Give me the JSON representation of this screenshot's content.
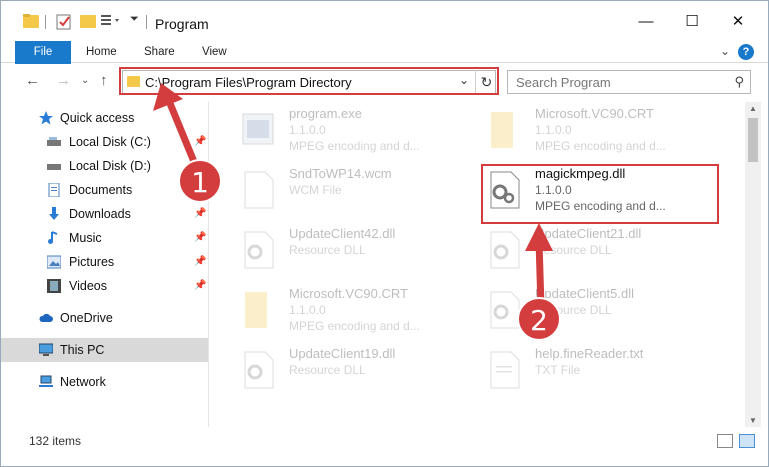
{
  "window": {
    "title": "Program"
  },
  "ribbon": {
    "file": "File",
    "home": "Home",
    "share": "Share",
    "view": "View",
    "help": "?"
  },
  "address": {
    "path": "C:\\Program Files\\Program Directory"
  },
  "search": {
    "placeholder": "Search Program"
  },
  "sidebar": {
    "items": [
      {
        "label": "Quick access"
      },
      {
        "label": "Local Disk (C:)"
      },
      {
        "label": "Local Disk (D:)"
      },
      {
        "label": "Documents"
      },
      {
        "label": "Downloads"
      },
      {
        "label": "Music"
      },
      {
        "label": "Pictures"
      },
      {
        "label": "Videos"
      },
      {
        "label": "OneDrive"
      },
      {
        "label": "This PC"
      },
      {
        "label": "Network"
      }
    ]
  },
  "files": [
    {
      "name": "program.exe",
      "line1": "1.1.0.0",
      "line2": "MPEG encoding and d..."
    },
    {
      "name": "Microsoft.VC90.CRT",
      "line1": "1.1.0.0",
      "line2": "MPEG encoding and d..."
    },
    {
      "name": "SndToWP14.wcm",
      "line1": "WCM File",
      "line2": ""
    },
    {
      "name": "magickmpeg.dll",
      "line1": "1.1.0.0",
      "line2": "MPEG encoding and d..."
    },
    {
      "name": "UpdateClient42.dll",
      "line1": "Resource DLL",
      "line2": ""
    },
    {
      "name": "UpdateClient21.dll",
      "line1": "Resource DLL",
      "line2": ""
    },
    {
      "name": "Microsoft.VC90.CRT",
      "line1": "1.1.0.0",
      "line2": "MPEG encoding and d..."
    },
    {
      "name": "UpdateClient5.dll",
      "line1": "Resource DLL",
      "line2": ""
    },
    {
      "name": "UpdateClient19.dll",
      "line1": "Resource DLL",
      "line2": ""
    },
    {
      "name": "help.fineReader.txt",
      "line1": "TXT File",
      "line2": ""
    }
  ],
  "status": {
    "count": "132 items"
  },
  "annotations": {
    "step1": "1",
    "step2": "2",
    "color": "#d43d3d"
  }
}
